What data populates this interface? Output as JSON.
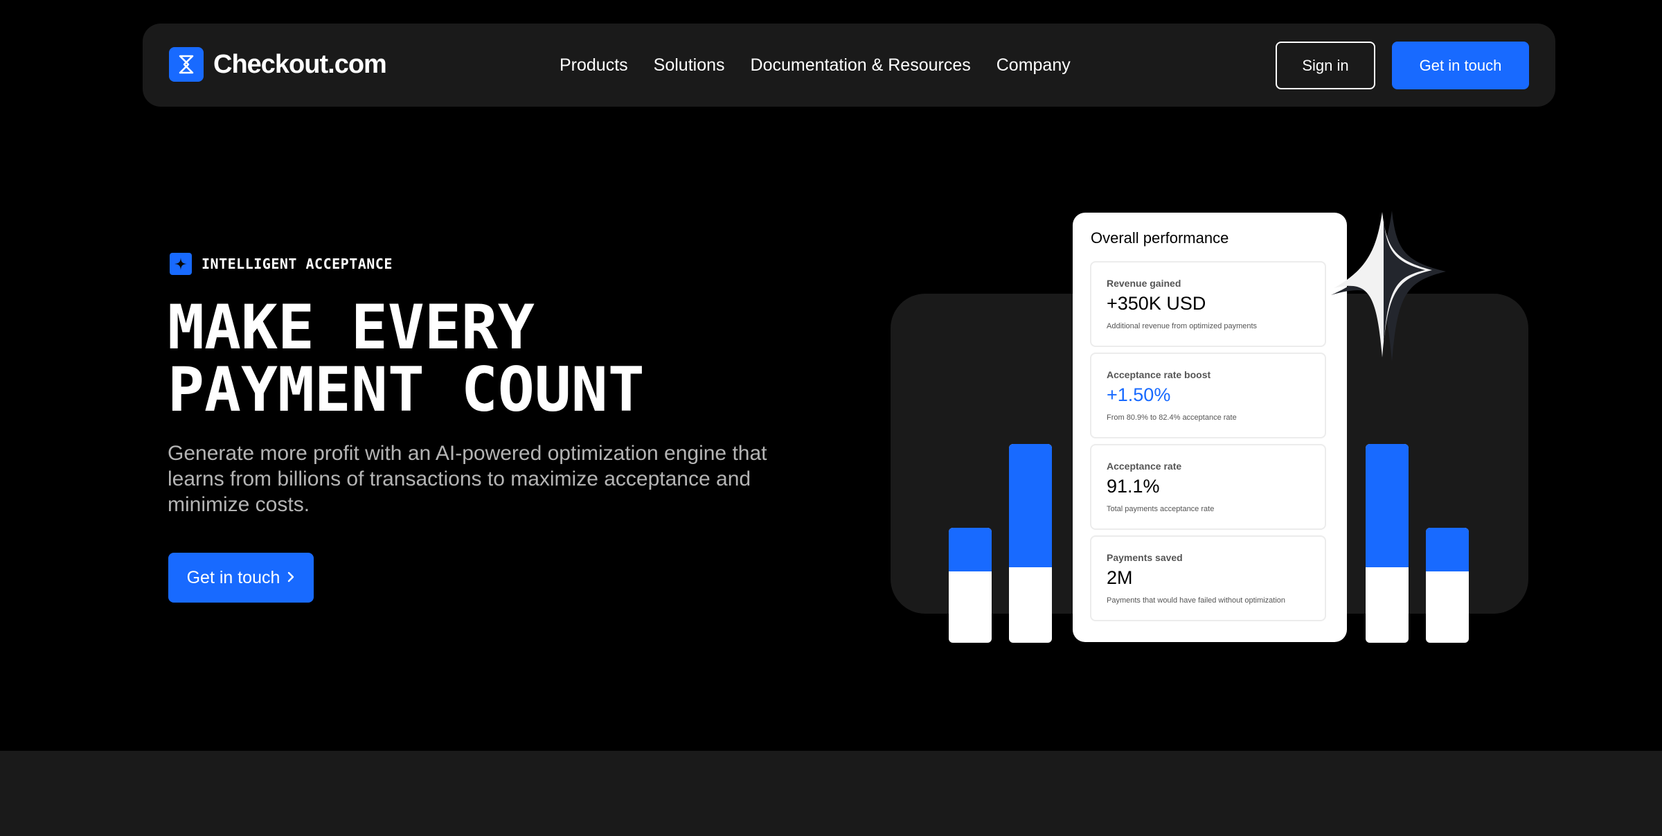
{
  "nav": {
    "logo_text": "Checkout.com",
    "links": [
      "Products",
      "Solutions",
      "Documentation & Resources",
      "Company"
    ],
    "signin_label": "Sign in",
    "cta_label": "Get in touch"
  },
  "hero": {
    "eyebrow": "INTELLIGENT ACCEPTANCE",
    "headline_line1": "MAKE EVERY",
    "headline_line2": "PAYMENT COUNT",
    "subtext": "Generate more profit with an AI-powered optimization engine that learns from billions of transactions to maximize acceptance and minimize costs.",
    "cta_label": "Get in touch",
    "cta_icon": "chevron-right-icon"
  },
  "performance_card": {
    "title": "Overall performance",
    "metrics": [
      {
        "label": "Revenue gained",
        "value": "+350K USD",
        "desc": "Additional revenue from optimized payments"
      },
      {
        "label": "Acceptance rate boost",
        "value": "+1.50%",
        "desc": "From 80.9% to 82.4% acceptance rate"
      },
      {
        "label": "Acceptance rate",
        "value": "91.1%",
        "desc": "Total payments acceptance rate"
      },
      {
        "label": "Payments saved",
        "value": "2M",
        "desc": "Payments that would have failed without optimization"
      }
    ]
  },
  "illustration": {
    "bars": [
      {
        "blue_fraction": 0.38
      },
      {
        "blue_fraction": 0.62
      },
      {
        "blue_fraction": 0.62
      },
      {
        "blue_fraction": 0.38
      }
    ]
  },
  "colors": {
    "accent": "#186aff",
    "background": "#000000",
    "surface": "#1a1a1a",
    "muted_text": "#b4b4b4"
  }
}
